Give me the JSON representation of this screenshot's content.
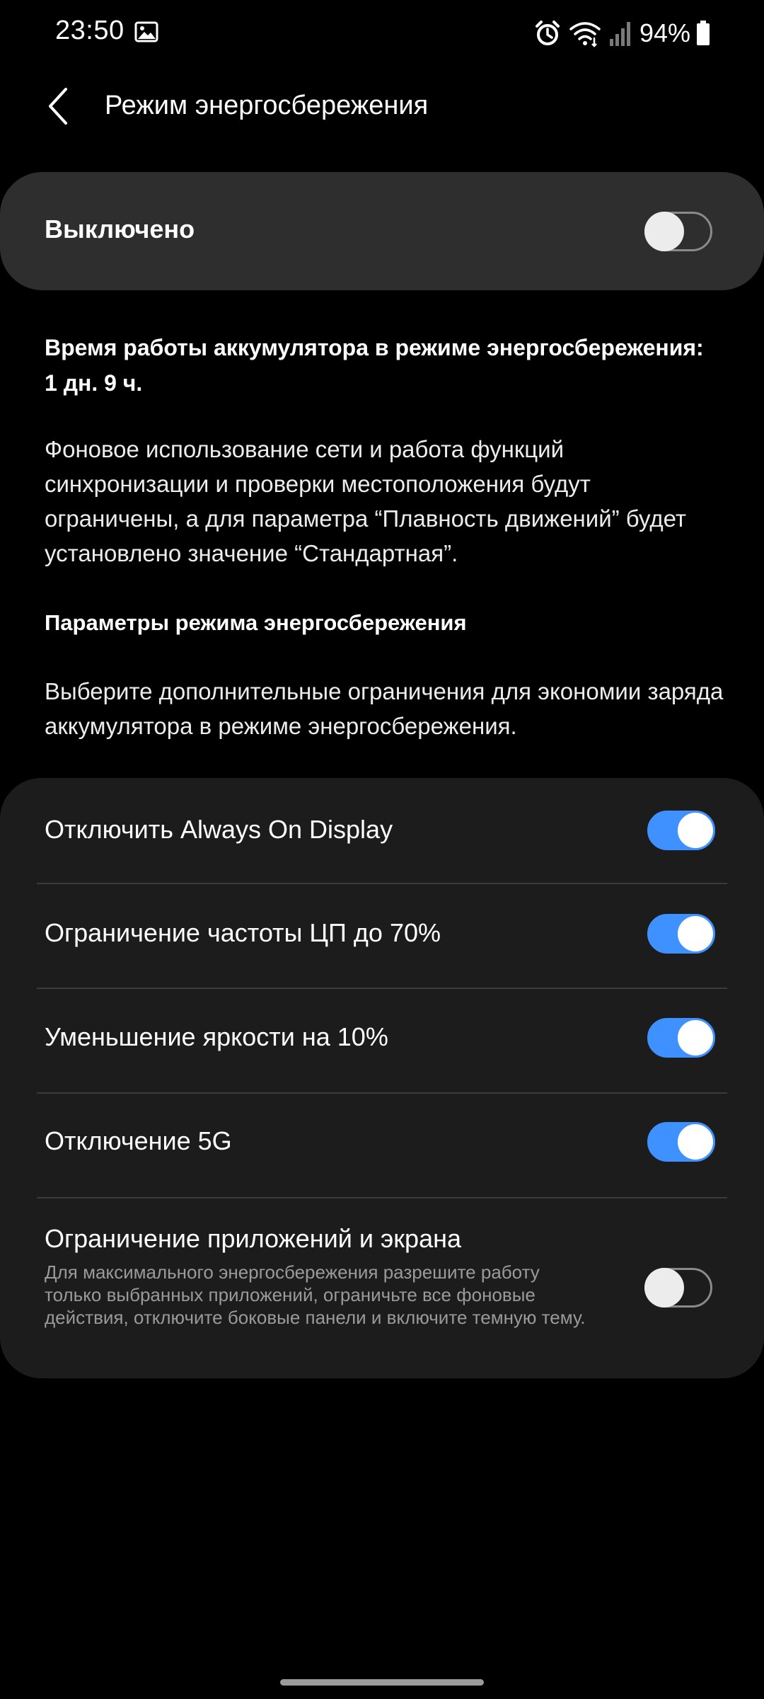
{
  "status_bar": {
    "time": "23:50",
    "battery_percent": "94%",
    "icons": [
      "gallery-icon",
      "alarm-icon",
      "wifi-icon",
      "signal-icon",
      "battery-icon"
    ]
  },
  "header": {
    "title": "Режим энергосбережения",
    "back_icon": "chevron-left-icon"
  },
  "master_toggle": {
    "label": "Выключено",
    "enabled": false
  },
  "info": {
    "runtime_line1": "Время работы аккумулятора в режиме энергосбережения:",
    "runtime_line2": "1 дн. 9 ч.",
    "description": "Фоновое использование сети и работа функций синхронизации и проверки местоположения будут ограничены, а для параметра “Плавность движений” будет установлено значение “Стандартная”.",
    "section_title": "Параметры режима энергосбережения",
    "section_desc": "Выберите дополнительные ограничения для экономии заряда аккумулятора в режиме энергосбережения."
  },
  "options": [
    {
      "label": "Отключить Always On Display",
      "enabled": true
    },
    {
      "label": "Ограничение частоты ЦП до 70%",
      "enabled": true
    },
    {
      "label": "Уменьшение яркости на 10%",
      "enabled": true
    },
    {
      "label": "Отключение 5G",
      "enabled": true
    },
    {
      "label": "Ограничение приложений и экрана",
      "description": "Для максимального энергосбережения разрешите работу только выбранных приложений, ограничьте все фоновые действия, отключите боковые панели и включите темную тему.",
      "enabled": false
    }
  ],
  "colors": {
    "accent": "#3e91ff",
    "background": "#000000",
    "card": "#2e2e2e",
    "options_card": "#1c1c1c"
  }
}
